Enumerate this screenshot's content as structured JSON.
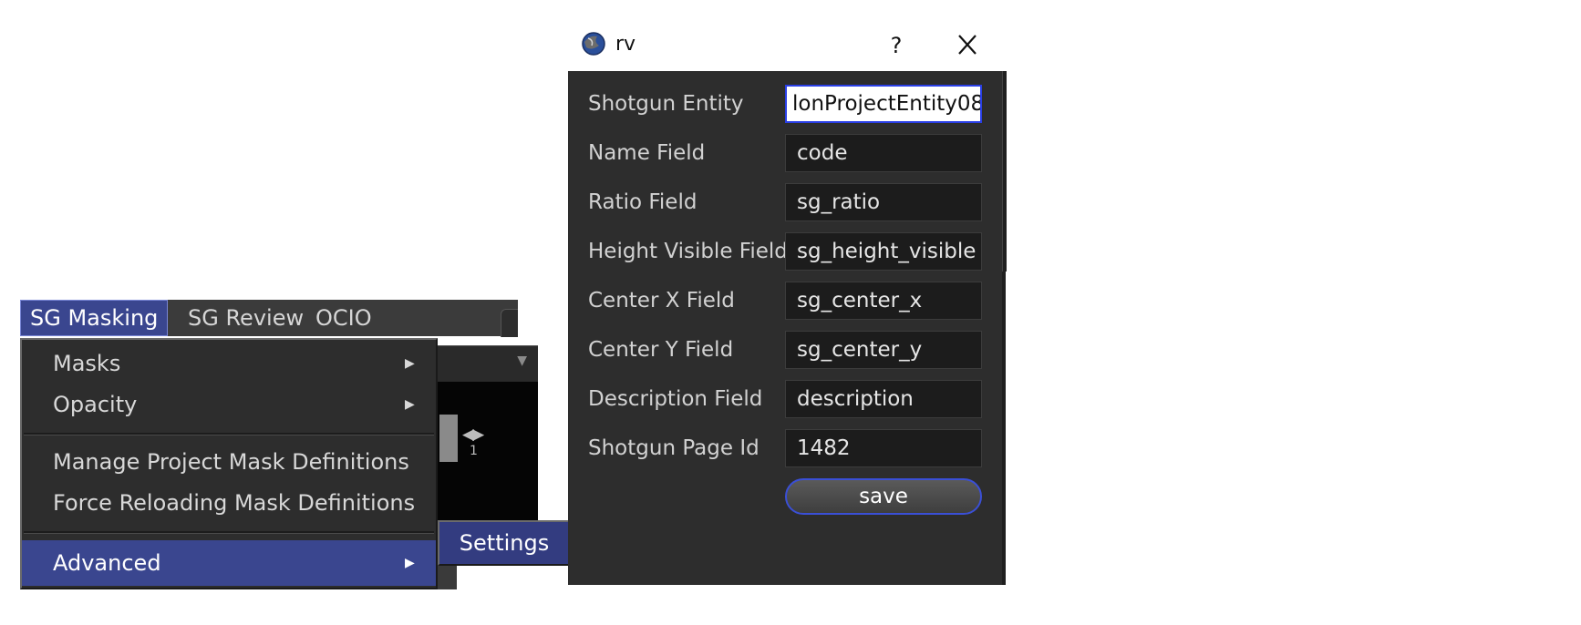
{
  "menubar": {
    "items": [
      "SG Masking",
      "SG Review",
      "OCIO"
    ]
  },
  "dropdown": {
    "items": [
      {
        "label": "Masks",
        "submenu": true
      },
      {
        "label": "Opacity",
        "submenu": true
      },
      {
        "label": "Manage Project Mask Definitions",
        "submenu": false
      },
      {
        "label": "Force Reloading Mask Definitions",
        "submenu": false
      },
      {
        "label": "Advanced",
        "submenu": true
      }
    ],
    "submenu_arrow": "▶"
  },
  "submenu": {
    "items": [
      "Settings"
    ]
  },
  "background": {
    "frame_number": "1"
  },
  "dialog": {
    "title": "rv",
    "help_label": "?",
    "icon": "rv-app-icon",
    "fields": [
      {
        "label": "Shotgun Entity",
        "value": "lonProjectEntity08"
      },
      {
        "label": "Name Field",
        "value": "code"
      },
      {
        "label": "Ratio Field",
        "value": "sg_ratio"
      },
      {
        "label": "Height Visible Field",
        "value": "sg_height_visible"
      },
      {
        "label": "Center X Field",
        "value": "sg_center_x"
      },
      {
        "label": "Center Y Field",
        "value": "sg_center_y"
      },
      {
        "label": "Description Field",
        "value": "description"
      },
      {
        "label": "Shotgun Page Id",
        "value": "1482"
      }
    ],
    "save_label": "save"
  },
  "colors": {
    "menu_highlight": "#3a468f",
    "focus_border": "#2a3fe6",
    "dialog_bg": "#2d2d2d"
  }
}
